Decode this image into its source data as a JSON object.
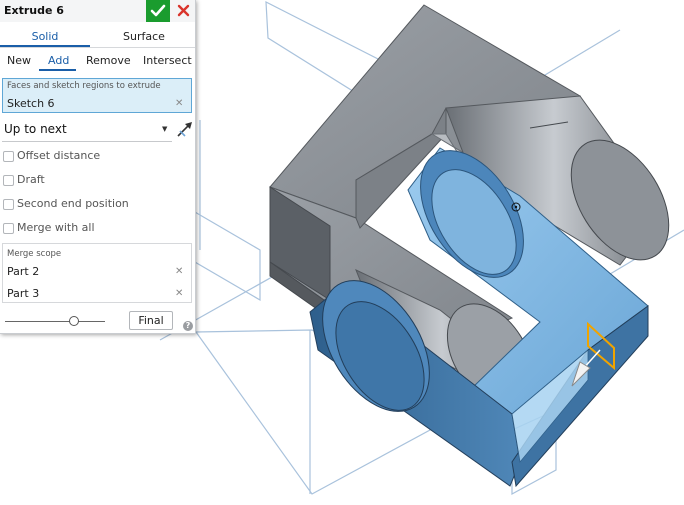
{
  "dialog": {
    "title": "Extrude 6",
    "tabs": [
      {
        "label": "Solid",
        "active": true
      },
      {
        "label": "Surface",
        "active": false
      }
    ],
    "operations": [
      {
        "label": "New",
        "active": false
      },
      {
        "label": "Add",
        "active": true
      },
      {
        "label": "Remove",
        "active": false
      },
      {
        "label": "Intersect",
        "active": false
      }
    ],
    "selection": {
      "label": "Faces and sketch regions to extrude",
      "items": [
        "Sketch 6"
      ]
    },
    "end_type": "Up to next",
    "options": [
      {
        "label": "Offset distance",
        "checked": false
      },
      {
        "label": "Draft",
        "checked": false
      },
      {
        "label": "Second end position",
        "checked": false
      },
      {
        "label": "Merge with all",
        "checked": false
      }
    ],
    "merge_scope": {
      "label": "Merge scope",
      "items": [
        "Part 2",
        "Part 3"
      ]
    },
    "final_label": "Final",
    "help_glyph": "?"
  },
  "colors": {
    "accent": "#1a5ea8",
    "confirm": "#1a9c2e",
    "cancel": "#d9342b",
    "selection_bg": "#dbeef8",
    "selection_border": "#5fa7d6",
    "part_gray": "#8a8f96",
    "part_blue": "#5a9bd0",
    "manipulator": "#f0a400"
  }
}
